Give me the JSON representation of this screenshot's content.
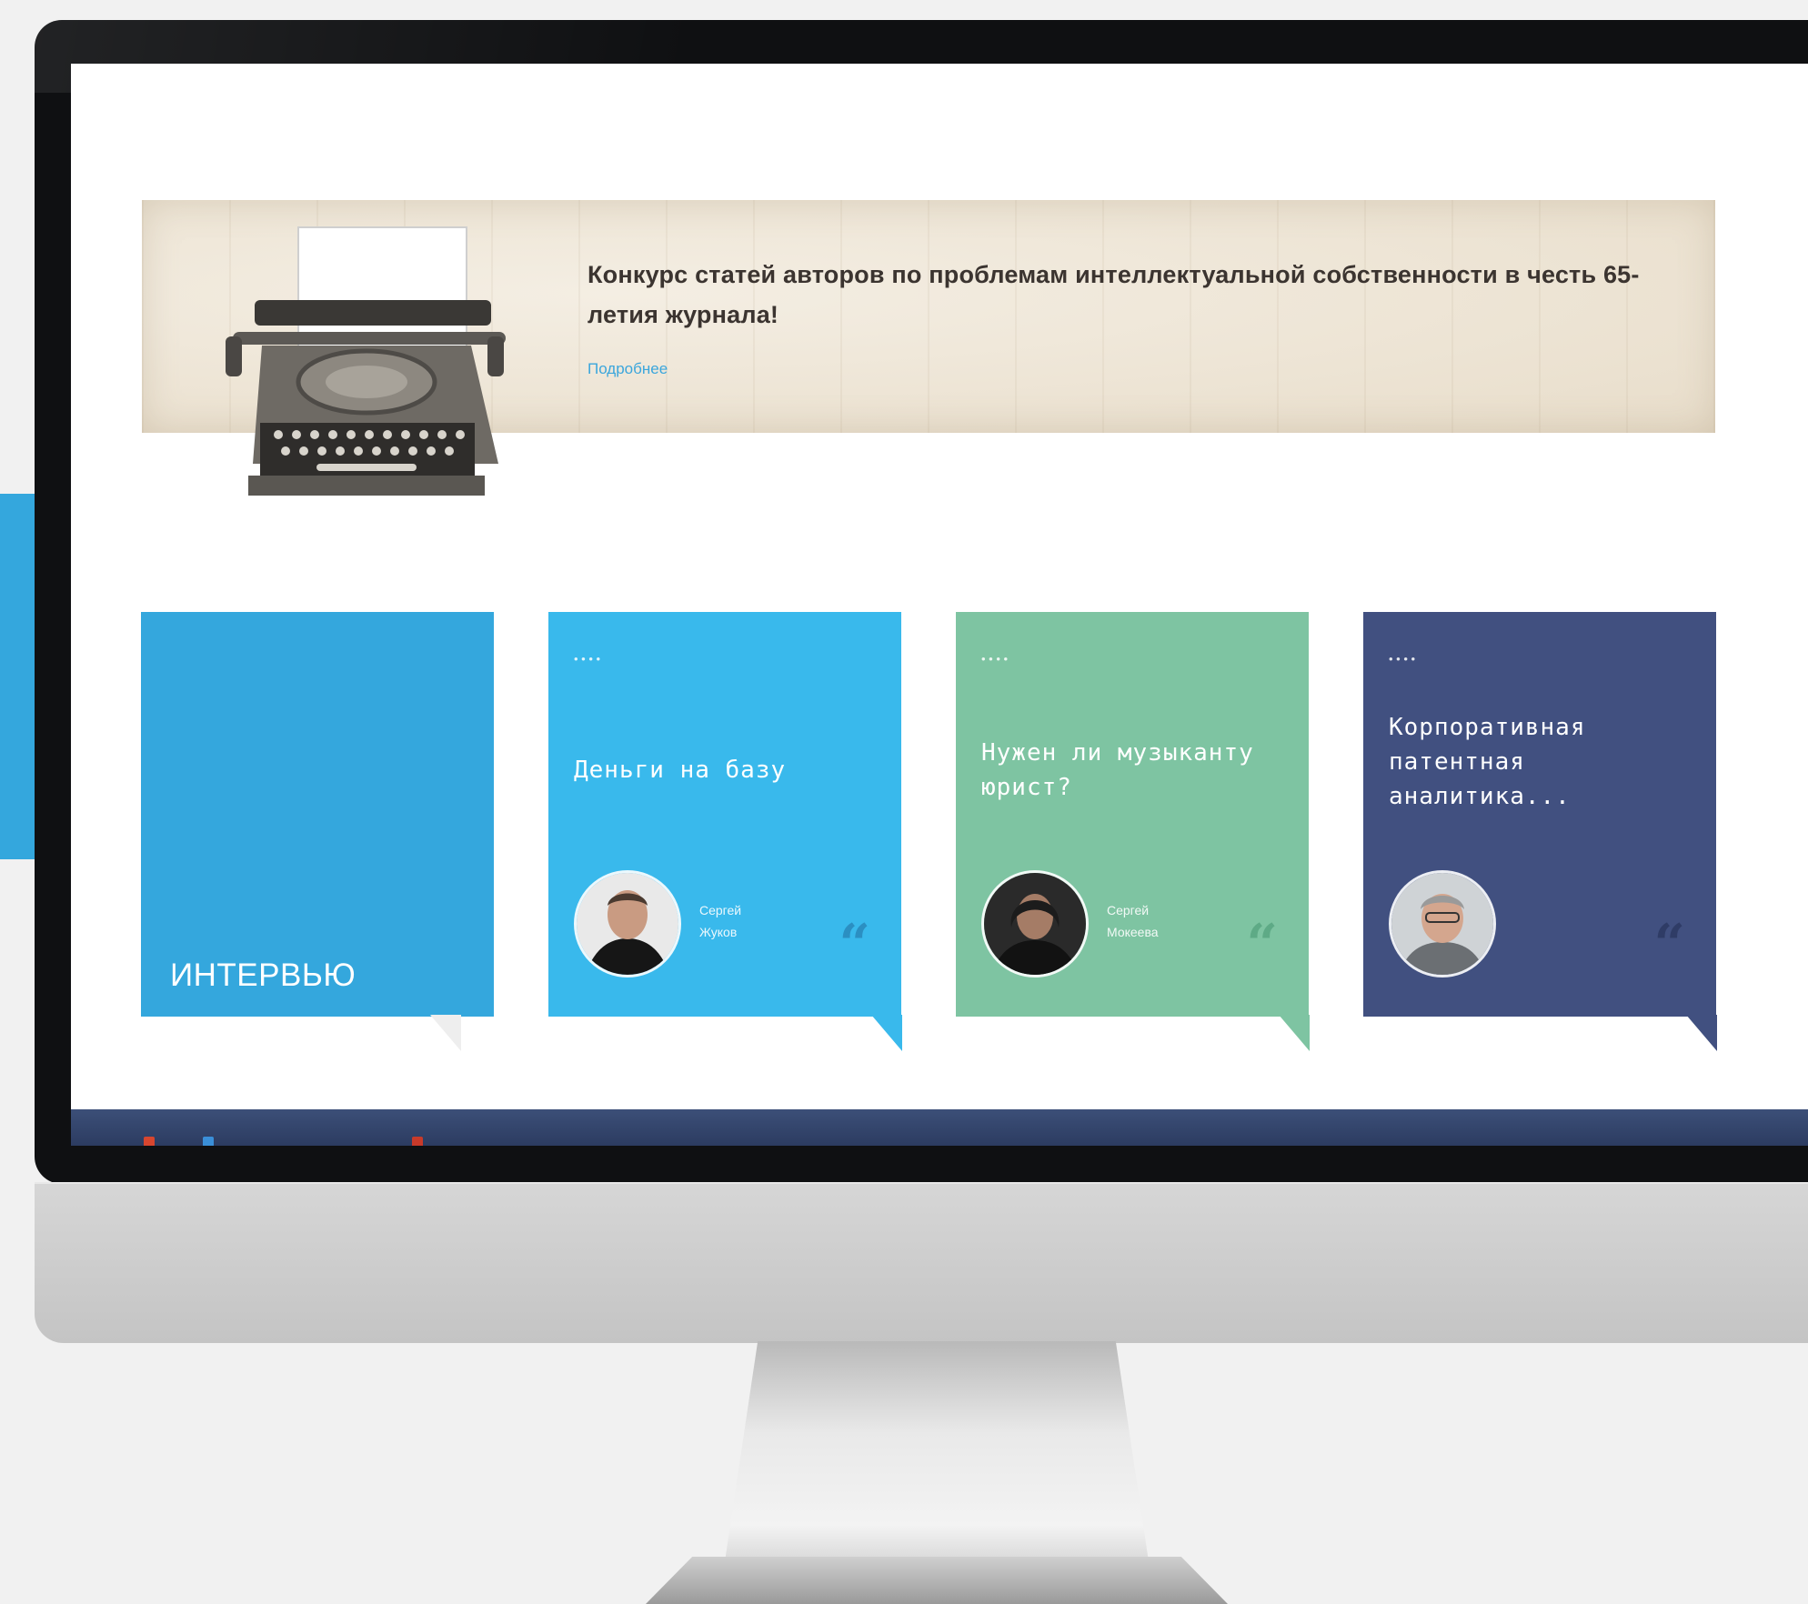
{
  "colors": {
    "accent_blue": "#34a7dd",
    "card_sky": "#39b9ec",
    "card_green": "#7ec4a2",
    "card_navy": "#415080",
    "banner_link": "#3ba6dc"
  },
  "banner": {
    "title": "Конкурс статей авторов по проблемам интеллектуальной собственности в честь 65-летия журнала!",
    "link": "Подробнее"
  },
  "section": {
    "label": "ИНТЕРВЬЮ"
  },
  "cards": [
    {
      "title": "Деньги на базу",
      "author_first": "Сергей",
      "author_last": "Жуков",
      "quote_icon": "quote-icon"
    },
    {
      "title": "Нужен ли музыканту юрист?",
      "author_first": "Сергей",
      "author_last": "Мокеева",
      "quote_icon": "quote-icon"
    },
    {
      "title": "Корпоративная патентная аналитика...",
      "author_first": "",
      "author_last": "",
      "quote_icon": "quote-icon"
    }
  ]
}
